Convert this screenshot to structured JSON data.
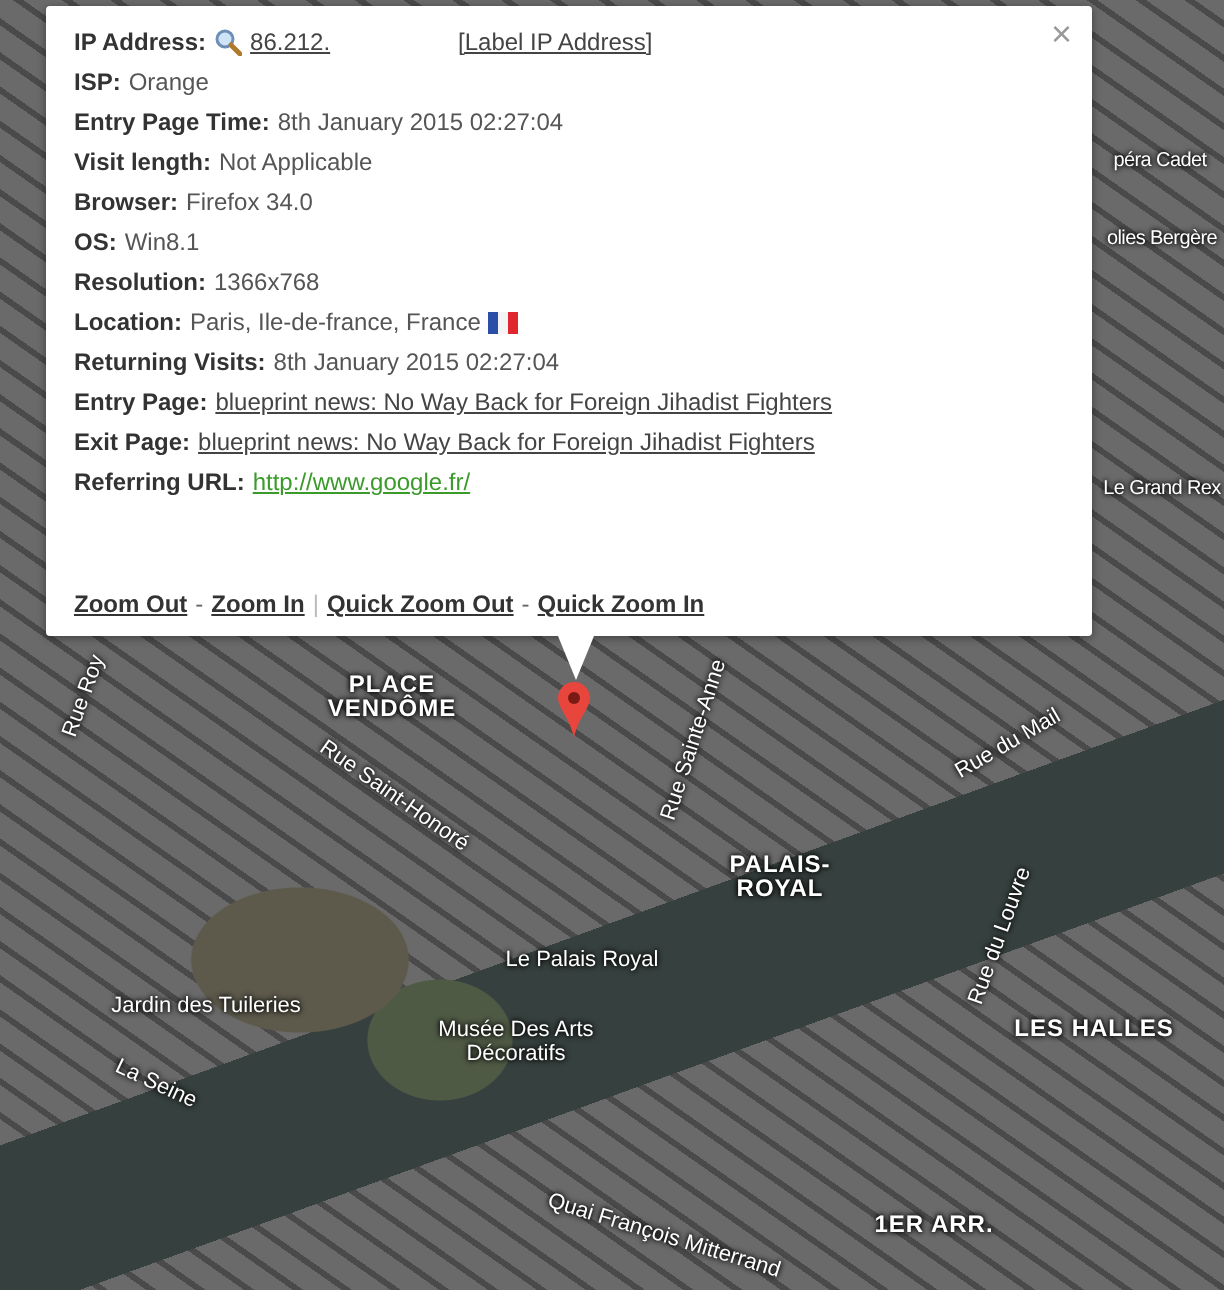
{
  "popup": {
    "fields": [
      {
        "kind": "ip",
        "label": "IP Address:",
        "value": "86.212.",
        "action": "[Label IP Address]"
      },
      {
        "kind": "text",
        "label": "ISP:",
        "value": "Orange"
      },
      {
        "kind": "text",
        "label": "Entry Page Time:",
        "value": "8th January 2015 02:27:04"
      },
      {
        "kind": "text",
        "label": "Visit length:",
        "value": "Not Applicable"
      },
      {
        "kind": "text",
        "label": "Browser:",
        "value": "Firefox 34.0"
      },
      {
        "kind": "text",
        "label": "OS:",
        "value": "Win8.1"
      },
      {
        "kind": "text",
        "label": "Resolution:",
        "value": "1366x768"
      },
      {
        "kind": "location",
        "label": "Location:",
        "value": "Paris, Ile-de-france, France"
      },
      {
        "kind": "text",
        "label": "Returning Visits:",
        "value": "8th January 2015 02:27:04"
      },
      {
        "kind": "link",
        "label": "Entry Page:",
        "value": "blueprint news: No Way Back for Foreign Jihadist Fighters"
      },
      {
        "kind": "link",
        "label": "Exit Page:",
        "value": "blueprint news: No Way Back for Foreign Jihadist Fighters"
      },
      {
        "kind": "url",
        "label": "Referring URL:",
        "value": "http://www.google.fr/"
      }
    ],
    "footer": [
      {
        "kind": "link",
        "text": "Zoom Out"
      },
      {
        "kind": "sep",
        "text": "-"
      },
      {
        "kind": "link",
        "text": "Zoom In"
      },
      {
        "kind": "bar",
        "text": "|"
      },
      {
        "kind": "link",
        "text": "Quick Zoom Out"
      },
      {
        "kind": "sep",
        "text": "-"
      },
      {
        "kind": "link",
        "text": "Quick Zoom In"
      }
    ],
    "close": "×"
  },
  "map": {
    "labels": [
      {
        "kind": "poi",
        "text": "péra Cadet"
      },
      {
        "kind": "poi",
        "text": "olies Bergère"
      },
      {
        "kind": "poi",
        "text": "Le Grand Rex"
      },
      {
        "kind": "street",
        "text": "Rue Roy"
      },
      {
        "kind": "district",
        "text": "PLACE VENDÔME"
      },
      {
        "kind": "street",
        "text": "Rue Saint-Honoré"
      },
      {
        "kind": "street",
        "text": "Rue Sainte-Anne"
      },
      {
        "kind": "street",
        "text": "Rue du Mail"
      },
      {
        "kind": "district",
        "text": "PALAIS-ROYAL"
      },
      {
        "kind": "poi",
        "text": "Le Palais Royal"
      },
      {
        "kind": "poi",
        "text": "Jardin des Tuileries"
      },
      {
        "kind": "poi",
        "text": "Musée Des Arts Décoratifs"
      },
      {
        "kind": "street",
        "text": "La Seine"
      },
      {
        "kind": "street",
        "text": "Rue du Louvre"
      },
      {
        "kind": "district",
        "text": "LES HALLES"
      },
      {
        "kind": "street",
        "text": "Quai François Mitterrand"
      },
      {
        "kind": "district",
        "text": "1ER ARR."
      }
    ]
  }
}
